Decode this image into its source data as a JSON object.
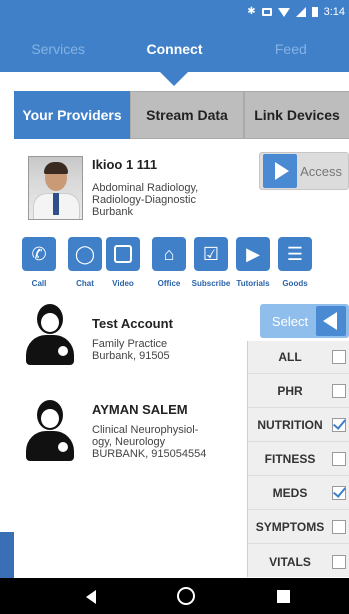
{
  "status": {
    "time": "3:14"
  },
  "nav": {
    "tabs": [
      "Services",
      "Connect",
      "Feed"
    ],
    "active": "Connect"
  },
  "segments": {
    "items": [
      "Your Providers",
      "Stream Data",
      "Link Devices"
    ],
    "active": "Your Providers"
  },
  "provider": {
    "name": "Ikioo 1 111",
    "desc_line1": "Abdominal Radiology,",
    "desc_line2": "Radiology-Diagnostic",
    "desc_line3": "Burbank",
    "access_label": "Access"
  },
  "actions": {
    "call": "Call",
    "chat": "Chat",
    "video": "Video",
    "office": "Office",
    "subscribe": "Subscribe",
    "tutorials": "Tutorials",
    "goods": "Goods"
  },
  "contacts": [
    {
      "name": "Test Account",
      "line1": "Family Practice",
      "line2": "Burbank, 91505",
      "line3": ""
    },
    {
      "name": "AYMAN SALEM",
      "line1": "Clinical Neurophysiol-",
      "line2": "ogy, Neurology",
      "line3": "BURBANK, 915054554"
    }
  ],
  "select": {
    "label": "Select"
  },
  "filters": [
    {
      "label": "ALL",
      "checked": false
    },
    {
      "label": "PHR",
      "checked": false
    },
    {
      "label": "NUTRITION",
      "checked": true
    },
    {
      "label": "FITNESS",
      "checked": false
    },
    {
      "label": "MEDS",
      "checked": true
    },
    {
      "label": "SYMPTOMS",
      "checked": false
    },
    {
      "label": "VITALS",
      "checked": false
    }
  ],
  "colors": {
    "primary": "#3f80c9",
    "tab_inactive": "#bdbdbd",
    "select_light": "#8fbdec"
  }
}
